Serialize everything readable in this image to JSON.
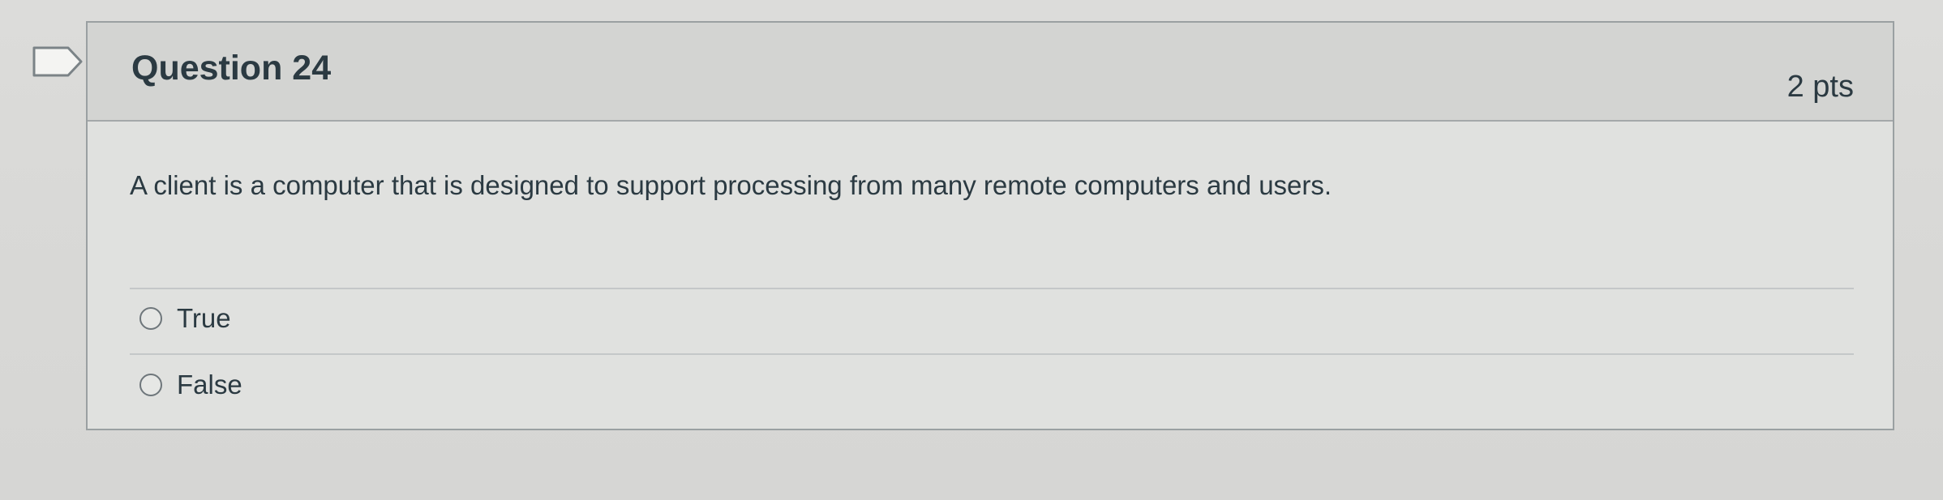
{
  "question": {
    "title": "Question 24",
    "points": "2 pts",
    "text": "A client is a computer that is designed to support processing from many remote computers and users.",
    "flag_icon": "flag-bookmark-icon",
    "answers": [
      {
        "label": "True",
        "selected": false
      },
      {
        "label": "False",
        "selected": false
      }
    ]
  }
}
